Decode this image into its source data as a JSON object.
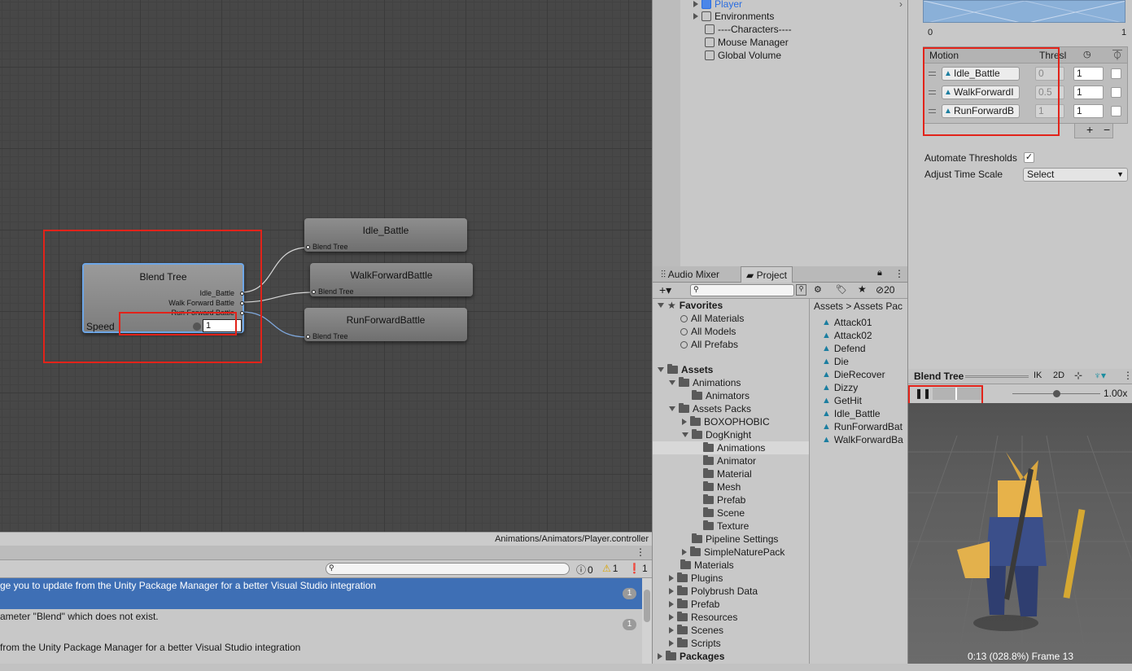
{
  "graph": {
    "blend_tree_node": {
      "title": "Blend Tree",
      "ports": [
        "Idle_Battle",
        "Walk Forward Battle",
        "Run Forward Battle"
      ],
      "param_label": "Speed",
      "param_value": "1"
    },
    "motion_nodes": [
      {
        "title": "Idle_Battle",
        "port": "Blend Tree"
      },
      {
        "title": "WalkForwardBattle",
        "port": "Blend Tree"
      },
      {
        "title": "RunForwardBattle",
        "port": "Blend Tree"
      }
    ],
    "path": "Animations/Animators/Player.controller"
  },
  "console": {
    "counts": {
      "info": "0",
      "warning": "1",
      "error": "1"
    },
    "messages": [
      {
        "text": "ge you to update from the Unity Package Manager for a better Visual Studio integration",
        "count": "1"
      },
      {
        "text": "ameter \"Blend\" which does not exist.",
        "count": "1"
      },
      {
        "text": "from the Unity Package Manager for a better Visual Studio integration",
        "count": ""
      }
    ]
  },
  "hierarchy": {
    "items": [
      {
        "label": "Player",
        "icon": "cube-icon",
        "selected_color": "#2a6de0"
      },
      {
        "label": "Environments",
        "icon": "cube-icon"
      },
      {
        "label": "----Characters----",
        "icon": "cube-icon"
      },
      {
        "label": "Mouse Manager",
        "icon": "cube-icon"
      },
      {
        "label": "Global Volume",
        "icon": "cube-icon"
      }
    ]
  },
  "project": {
    "tabs": [
      "Audio Mixer",
      "Project"
    ],
    "hidden_count": "20",
    "breadcrumb": "Assets  >  Assets Pac",
    "tree": {
      "favorites": {
        "label": "Favorites",
        "items": [
          "All Materials",
          "All Models",
          "All Prefabs"
        ]
      },
      "assets": "Assets",
      "animations": "Animations",
      "animators": "Animators",
      "assets_packs": "Assets Packs",
      "boxophobic": "BOXOPHOBIC",
      "dogknight": "DogKnight",
      "dog_children": [
        "Animations",
        "Animator",
        "Material",
        "Mesh",
        "Prefab",
        "Scene",
        "Texture"
      ],
      "pipeline": "Pipeline Settings",
      "simplenature": "SimpleNaturePack",
      "root_folders": [
        "Materials",
        "Plugins",
        "Polybrush Data",
        "Prefab",
        "Resources",
        "Scenes",
        "Scripts"
      ],
      "packages": "Packages"
    },
    "files": [
      "Attack01",
      "Attack02",
      "Defend",
      "Die",
      "DieRecover",
      "Dizzy",
      "GetHit",
      "Idle_Battle",
      "RunForwardBat",
      "WalkForwardBa"
    ]
  },
  "inspector": {
    "graph_min": "0",
    "graph_max": "1",
    "motion_header": "Motion",
    "thresh_header": "Thresl",
    "motions": [
      {
        "name": "Idle_Battle",
        "threshold": "0",
        "speed": "1"
      },
      {
        "name": "WalkForwardI",
        "threshold": "0.5",
        "speed": "1"
      },
      {
        "name": "RunForwardB",
        "threshold": "1",
        "speed": "1"
      }
    ],
    "automate_label": "Automate Thresholds",
    "adjust_label": "Adjust Time Scale",
    "adjust_value": "Select"
  },
  "preview": {
    "title": "Blend Tree",
    "ik": "IK",
    "twod": "2D",
    "speed": "1.00x",
    "status": "0:13 (028.8%) Frame 13"
  }
}
